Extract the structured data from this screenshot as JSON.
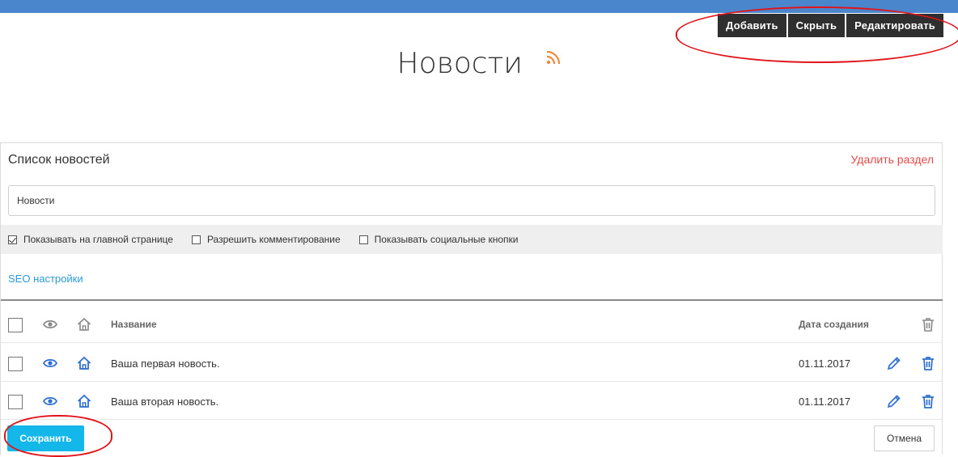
{
  "toolbar": {
    "add": "Добавить",
    "hide": "Скрыть",
    "edit": "Редактировать"
  },
  "page": {
    "title": "Новости",
    "rss_icon": "rss-icon",
    "rss_color": "#f0883e"
  },
  "section": {
    "title": "Список новостей",
    "delete": "Удалить раздел",
    "name_value": "Новости"
  },
  "options": [
    {
      "label": "Показывать на главной странице",
      "checked": true
    },
    {
      "label": "Разрешить комментирование",
      "checked": false
    },
    {
      "label": "Показывать социальные кнопки",
      "checked": false
    }
  ],
  "seo": "SEO настройки",
  "table": {
    "headers": {
      "name": "Название",
      "date": "Дата создания"
    },
    "rows": [
      {
        "name": "Ваша первая новость.",
        "date": "01.11.2017"
      },
      {
        "name": "Ваша вторая новость.",
        "date": "01.11.2017"
      }
    ]
  },
  "buttons": {
    "save": "Сохранить",
    "cancel": "Отмена"
  },
  "colors": {
    "accent": "#14b7ea",
    "link": "#2a9ad8",
    "danger": "#e34b4b",
    "icon_blue": "#2f6fd1",
    "annotation": "#e0141b"
  }
}
